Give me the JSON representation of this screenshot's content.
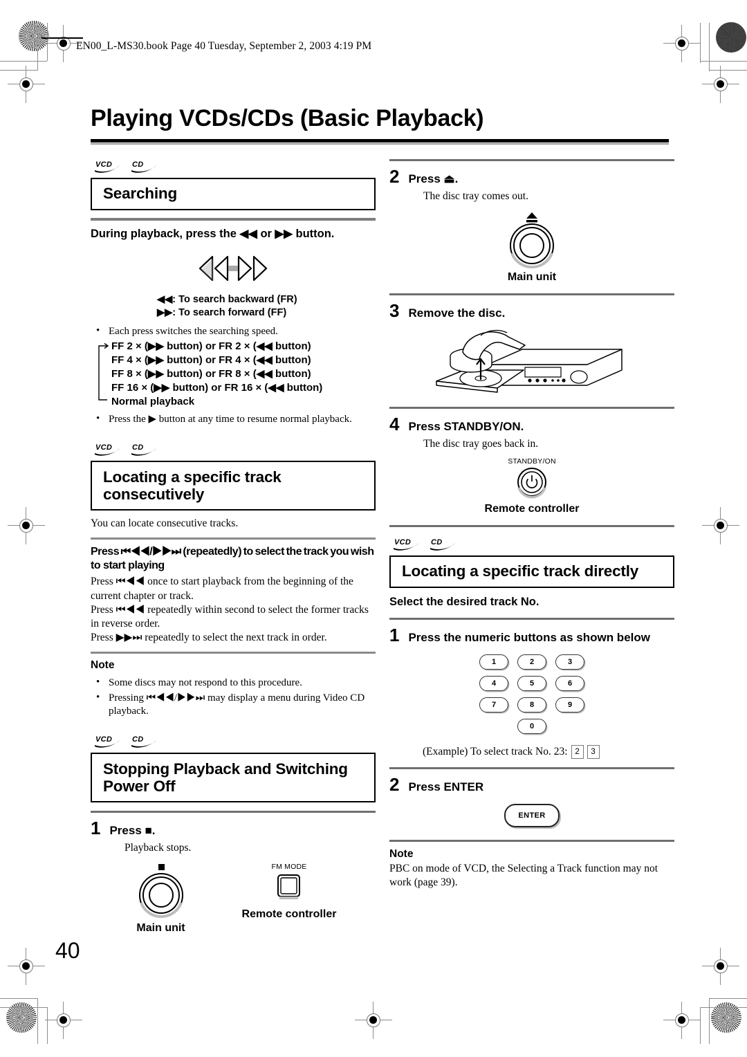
{
  "print_header": {
    "text": "EN00_L-MS30.book  Page 40  Tuesday, September 2, 2003  4:19 PM"
  },
  "page_title": "Playing VCDs/CDs (Basic Playback)",
  "page_number": "40",
  "media_badges": [
    "VCD",
    "CD"
  ],
  "left_column": {
    "searching": {
      "heading": "Searching",
      "lead": "During playback, press the ◀◀ or ▶▶ button.",
      "key_legend_backward": "◀◀: To search backward (FR)",
      "key_legend_forward": "▶▶: To search forward (FF)",
      "bullet_each_press": "Each press switches the searching speed.",
      "speed_steps": [
        "FF 2 × (▶▶ button) or FR 2 × (◀◀ button)",
        "FF 4 × (▶▶ button) or FR 4 × (◀◀ button)",
        "FF 8 × (▶▶ button) or FR 8 × (◀◀ button)",
        "FF 16 × (▶▶ button) or FR 16 × (◀◀ button)",
        "Normal playback"
      ],
      "bullet_resume": "Press the ▶ button at any time to resume normal playback."
    },
    "locating_consecutively": {
      "heading_line1": "Locating a specific track",
      "heading_line2": "consecutively",
      "intro": "You can locate consecutive tracks.",
      "lead_line1": "Press ⏮◀◀/▶▶⏭ (repeatedly) to select the track you wish",
      "lead_line2": "to start playing",
      "body_1": "Press ⏮◀◀ once to start playback from the beginning of the current chapter or track.",
      "body_2": "Press ⏮◀◀ repeatedly within second to select the former tracks in reverse order.",
      "body_3": "Press ▶▶⏭ repeatedly to select the next track in order.",
      "note_heading": "Note",
      "notes": [
        "Some discs may not respond to this procedure.",
        "Pressing ⏮◀◀/▶▶⏭ may display a menu during Video CD playback."
      ]
    },
    "stopping": {
      "heading_line1": "Stopping Playback and Switching",
      "heading_line2": "Power Off",
      "step1_num": "1",
      "step1_title": "Press ■.",
      "step1_body": "Playback stops.",
      "fig_main_unit_caption": "Main unit",
      "fig_remote_caption": "Remote controller",
      "fig_remote_button_label": "FM MODE"
    }
  },
  "right_column": {
    "step2": {
      "num": "2",
      "title": "Press ⏏.",
      "body": "The disc tray comes out.",
      "fig_caption": "Main unit"
    },
    "step3": {
      "num": "3",
      "title": "Remove the disc."
    },
    "step4": {
      "num": "4",
      "title": "Press STANDBY/ON.",
      "body": "The disc tray goes back in.",
      "fig_button_label": "STANDBY/ON",
      "fig_caption": "Remote controller"
    },
    "locating_directly": {
      "heading": "Locating a specific track directly",
      "lead": "Select the desired track No.",
      "step1_num": "1",
      "step1_title": "Press the numeric buttons as shown below",
      "keypad": [
        [
          "1",
          "2",
          "3"
        ],
        [
          "4",
          "5",
          "6"
        ],
        [
          "7",
          "8",
          "9"
        ],
        [
          "0"
        ]
      ],
      "example_text": "(Example) To select track No. 23:",
      "example_keys": [
        "2",
        "3"
      ],
      "step2_num": "2",
      "step2_title": "Press ENTER",
      "enter_button_label": "ENTER",
      "note_heading": "Note",
      "note_body": "PBC on mode of VCD, the Selecting a Track function may not work (page 39)."
    }
  }
}
